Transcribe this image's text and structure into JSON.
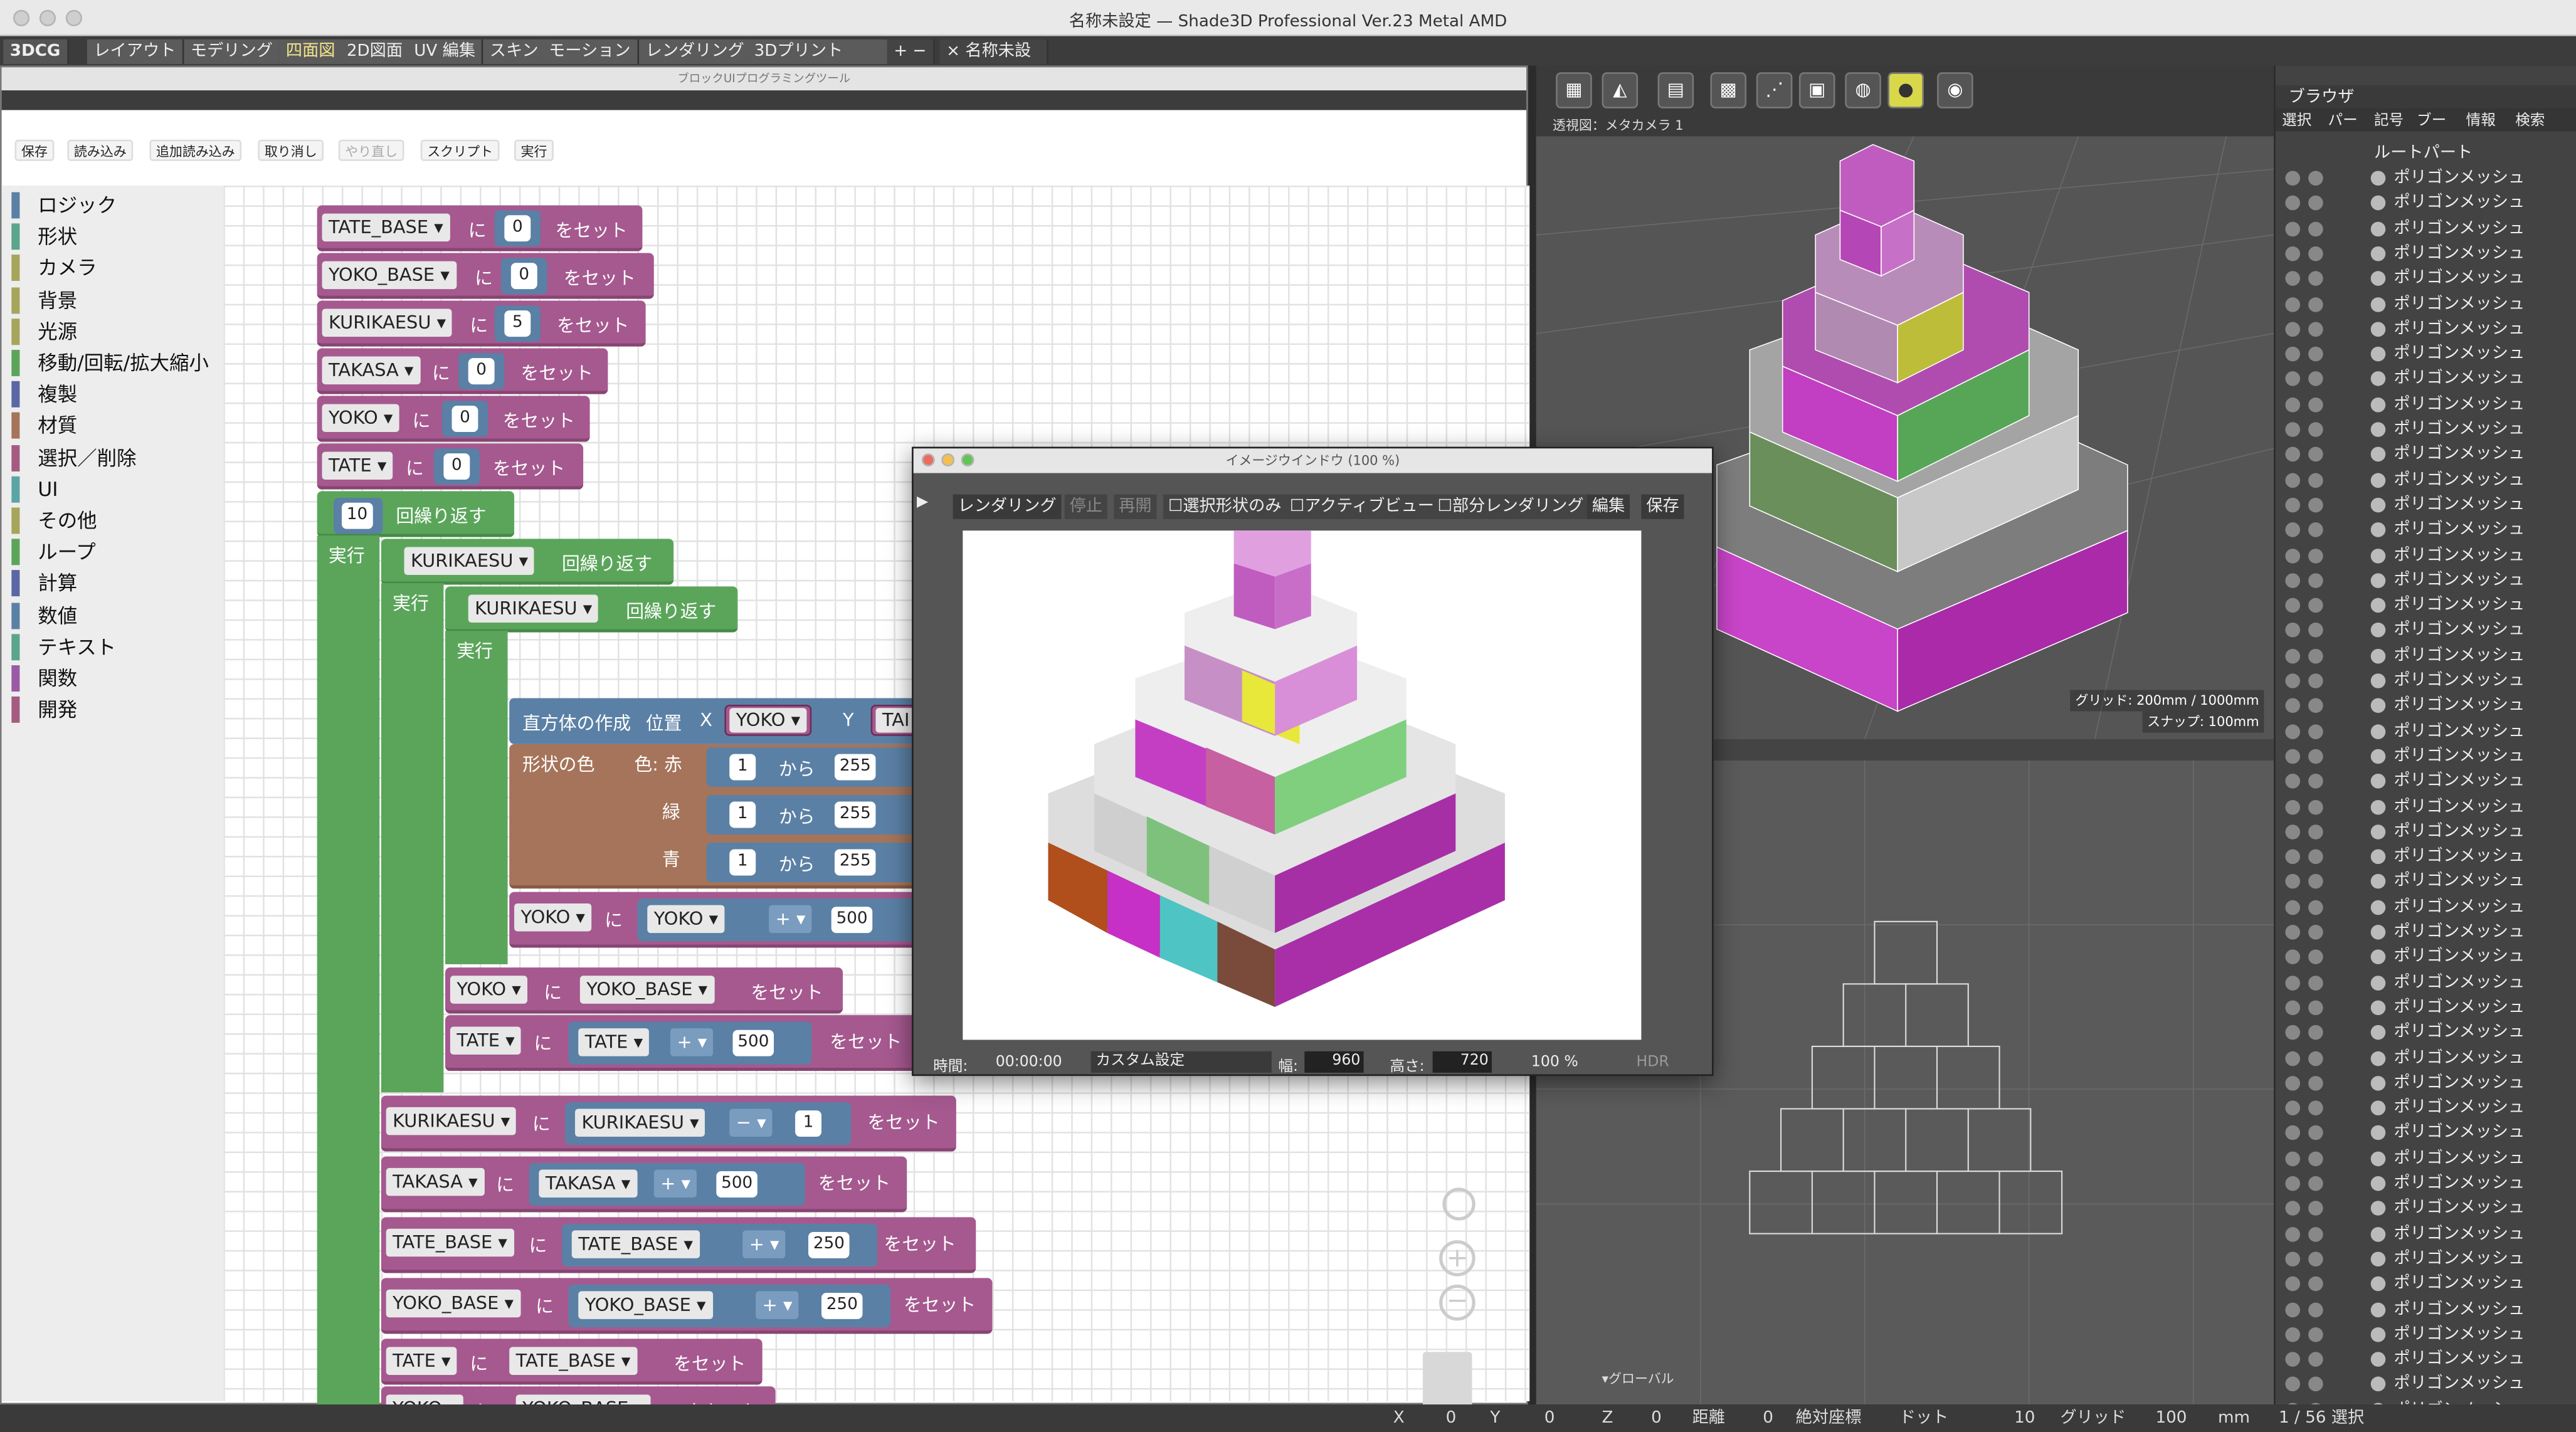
{
  "window_title": "名称未設定 — Shade3D Professional Ver.23 Metal AMD",
  "tabs": [
    "3DCG",
    "レイアウト",
    "モデリング",
    "四面図",
    "2D図面",
    "UV 編集",
    "スキン",
    "モーション",
    "レンダリング",
    "3Dプリント",
    "+ −",
    "× 名称未設定"
  ],
  "block_tool": {
    "title": "ブロックUIプログラミングツール",
    "toolbar": [
      "保存",
      "読み込み",
      "追加読み込み",
      "取り消し",
      "やり直し",
      "スクリプト",
      "実行"
    ],
    "categories": [
      {
        "label": "ロジック",
        "color": "#5b80a5"
      },
      {
        "label": "形状",
        "color": "#5ba58c"
      },
      {
        "label": "カメラ",
        "color": "#a5a55b"
      },
      {
        "label": "背景",
        "color": "#a5a55b"
      },
      {
        "label": "光源",
        "color": "#a5a55b"
      },
      {
        "label": "移動/回転/拡大縮小",
        "color": "#5ba55b"
      },
      {
        "label": "複製",
        "color": "#5b67a5"
      },
      {
        "label": "材質",
        "color": "#a5745a"
      },
      {
        "label": "選択／削除",
        "color": "#a55b80"
      },
      {
        "label": "UI",
        "color": "#5ba5a5"
      },
      {
        "label": "その他",
        "color": "#a5a55b"
      },
      {
        "label": "ループ",
        "color": "#5ba55b"
      },
      {
        "label": "計算",
        "color": "#5b67a5"
      },
      {
        "label": "数値",
        "color": "#5b80a5"
      },
      {
        "label": "テキスト",
        "color": "#5ba58c"
      },
      {
        "label": "関数",
        "color": "#995ba5"
      },
      {
        "label": "開発",
        "color": "#a55b80"
      }
    ],
    "set_label": "をセット",
    "ni": "に",
    "loop_label": "回繰り返す",
    "do_label": "実行",
    "blocks": {
      "b1": {
        "var": "TATE_BASE",
        "val": "0"
      },
      "b2": {
        "var": "YOKO_BASE",
        "val": "0"
      },
      "b3": {
        "var": "KURIKAESU",
        "val": "5"
      },
      "b4": {
        "var": "TAKASA",
        "val": "0"
      },
      "b5": {
        "var": "YOKO",
        "val": "0"
      },
      "b6": {
        "var": "TATE",
        "val": "0"
      },
      "loop1": "10",
      "loop2": "KURIKAESU",
      "loop3": "KURIKAESU",
      "cube": {
        "label": "直方体の作成",
        "pos": "位置",
        "x": "X",
        "xvar": "YOKO",
        "y": "Y",
        "yvar": "TAI"
      },
      "color": {
        "label": "形状の色",
        "r": "色: 赤",
        "g": "緑",
        "b": "青",
        "kara": "から",
        "v": "255",
        "v1": "1"
      },
      "yoko_inc": {
        "var": "YOKO",
        "inner": "YOKO",
        "op": "+",
        "val": "500"
      },
      "yoko_reset": {
        "var": "YOKO",
        "inner": "YOKO_BASE"
      },
      "tate_inc": {
        "var": "TATE",
        "inner": "TATE",
        "op": "+",
        "val": "500"
      },
      "kuri_dec": {
        "var": "KURIKAESU",
        "inner": "KURIKAESU",
        "op": "−",
        "val": "1"
      },
      "takasa_inc": {
        "var": "TAKASA",
        "inner": "TAKASA",
        "op": "+",
        "val": "500"
      },
      "tbase_inc": {
        "var": "TATE_BASE",
        "inner": "TATE_BASE",
        "op": "+",
        "val": "250"
      },
      "ybase_inc": {
        "var": "YOKO_BASE",
        "inner": "YOKO_BASE",
        "op": "+",
        "val": "250"
      },
      "tate_reset": {
        "var": "TATE",
        "inner": "TATE_BASE"
      },
      "yoko_reset2": {
        "var": "YOKO",
        "inner": "YOKO_BASE"
      }
    }
  },
  "viewport_top": {
    "label": "透視図：メタカメラ 1",
    "grid": "グリッド: 200mm / 1000mm",
    "snap": "スナップ: 100mm"
  },
  "viewport_bottom": {
    "label": "▾グローバル"
  },
  "browser": {
    "title": "ブラウザ",
    "tabs": [
      "選択",
      "パー",
      "記号",
      "ブー",
      "情報",
      "検索"
    ],
    "root": "ルートパート",
    "item": "ポリゴンメッシュ"
  },
  "image_window": {
    "title": "イメージウインドウ (100 %)",
    "buttons": [
      "レンダリング",
      "停止",
      "再開",
      "選択形状のみ",
      "アクティブビュー",
      "部分レンダリング",
      "編集",
      "保存"
    ],
    "time_label": "時間:",
    "time": "00:00:00",
    "preset": "カスタム設定",
    "w_label": "幅:",
    "w": "960",
    "h_label": "高さ:",
    "h": "720",
    "zoom": "100 %",
    "hdr": "HDR"
  },
  "status": {
    "x_label": "X",
    "x": "0",
    "y_label": "Y",
    "y": "0",
    "z_label": "Z",
    "z": "0",
    "dist_label": "距離",
    "dist": "0",
    "abs": "絶対座標",
    "dot": "ドット",
    "dot_v": "10",
    "grid": "グリッド",
    "grid_v": "100",
    "unit": "mm",
    "sel": "1 / 56 選択"
  },
  "colors": {
    "block_purple": "#a5598f",
    "loop_green": "#5ba55b",
    "color_brown": "#a5745a",
    "logic_blue": "#5b80a5"
  }
}
